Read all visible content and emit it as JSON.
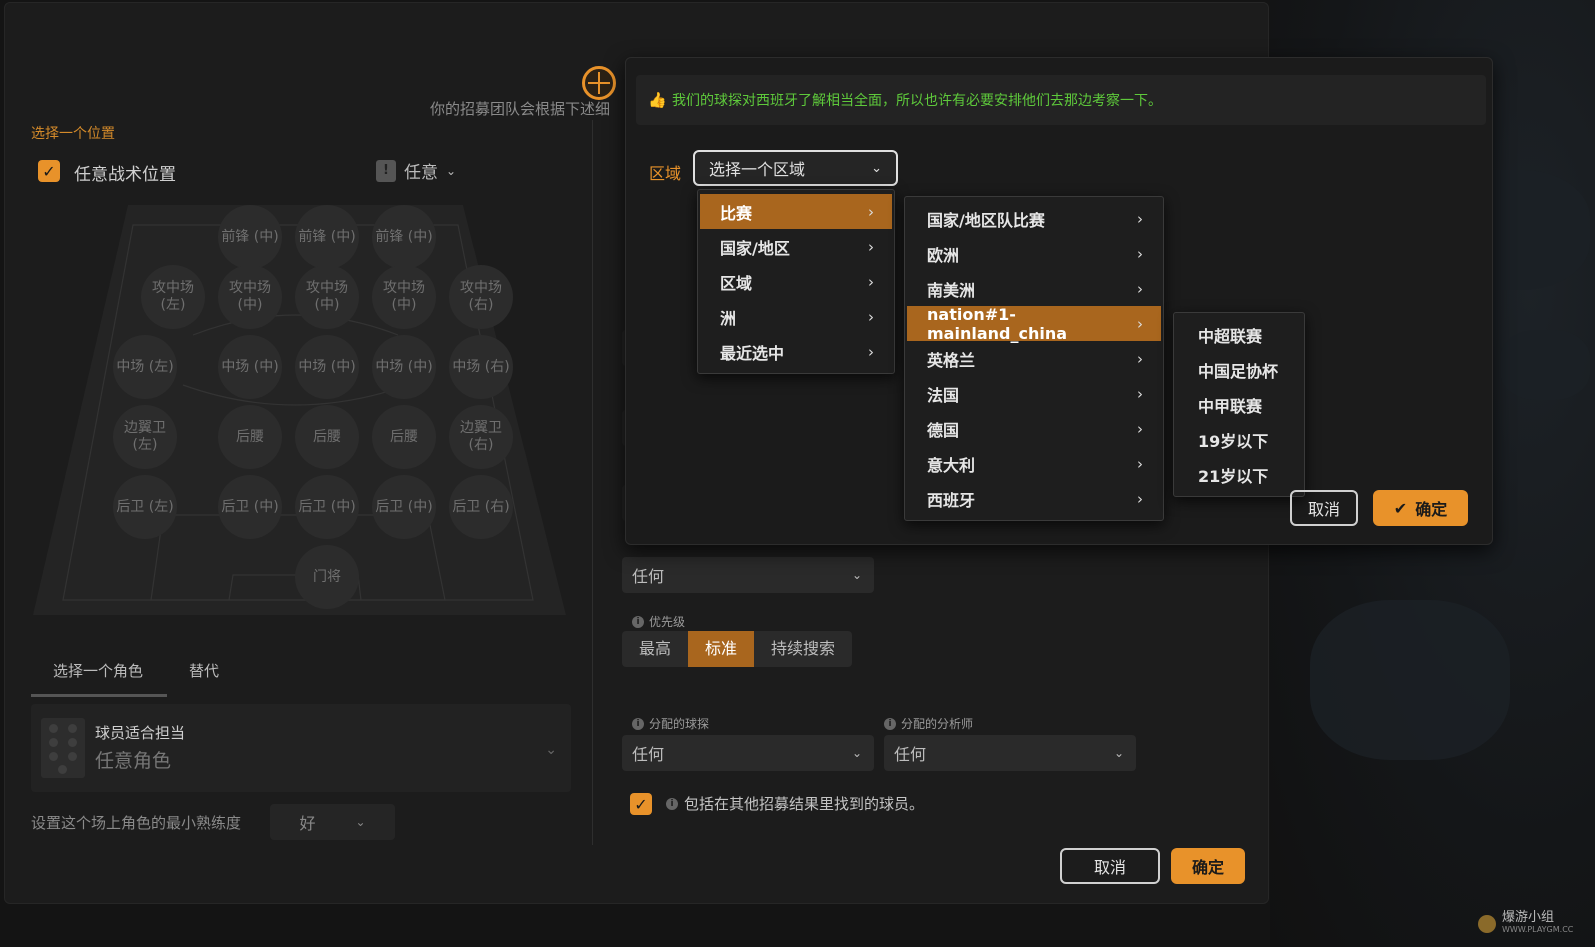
{
  "header": {
    "subtitle": "你的招募团队会根据下述细"
  },
  "left": {
    "position_title": "选择一个位置",
    "any_tactical_position": "任意战术位置",
    "any_selector": "任意",
    "pitch_positions": [
      {
        "label": "前锋 (中)"
      },
      {
        "label": "前锋 (中)"
      },
      {
        "label": "前锋 (中)"
      },
      {
        "label": "攻中场\n(左)"
      },
      {
        "label": "攻中场\n(中)"
      },
      {
        "label": "攻中场\n(中)"
      },
      {
        "label": "攻中场\n(中)"
      },
      {
        "label": "攻中场\n(右)"
      },
      {
        "label": "中场 (左)"
      },
      {
        "label": "中场 (中)"
      },
      {
        "label": "中场 (中)"
      },
      {
        "label": "中场 (中)"
      },
      {
        "label": "中场 (右)"
      },
      {
        "label": "边翼卫\n(左)"
      },
      {
        "label": "后腰"
      },
      {
        "label": "后腰"
      },
      {
        "label": "后腰"
      },
      {
        "label": "边翼卫\n(右)"
      },
      {
        "label": "后卫 (左)"
      },
      {
        "label": "后卫 (中)"
      },
      {
        "label": "后卫 (中)"
      },
      {
        "label": "后卫 (中)"
      },
      {
        "label": "后卫 (右)"
      },
      {
        "label": "门将"
      }
    ],
    "tabs": {
      "role": "选择一个角色",
      "alt": "替代"
    },
    "role_hint": "球员适合担当",
    "role_value": "任意角色",
    "min_skill_label": "设置这个场上角色的最小熟练度",
    "min_skill_value": "好"
  },
  "right": {
    "select_any_1": "任何",
    "priority_label": "优先级",
    "priority_options": [
      "最高",
      "标准",
      "持续搜索"
    ],
    "priority_selected": "标准",
    "scout_label": "分配的球探",
    "scout_value": "任何",
    "analyst_label": "分配的分析师",
    "analyst_value": "任何",
    "include_label": "包括在其他招募结果里找到的球员。",
    "cancel": "取消",
    "confirm": "确定"
  },
  "dialog": {
    "notice": "我们的球探对西班牙了解相当全面，所以也许有必要安排他们去那边考察一下。",
    "region_label": "区域",
    "region_select": "选择一个区域",
    "menu_l1": [
      "比赛",
      "国家/地区",
      "区域",
      "洲",
      "最近选中"
    ],
    "menu_l2": [
      "国家/地区队比赛",
      "欧洲",
      "南美洲",
      "nation#1-mainland_china",
      "英格兰",
      "法国",
      "德国",
      "意大利",
      "西班牙"
    ],
    "menu_l3": [
      "中超联赛",
      "中国足协杯",
      "中甲联赛",
      "19岁以下",
      "21岁以下"
    ],
    "cancel": "取消",
    "confirm": "确定"
  },
  "watermark": {
    "text": "爆游小组",
    "url": "WWW.PLAYGM.CC"
  },
  "colors": {
    "accent": "#e8922a",
    "accent_dark": "#a9661e",
    "notice_green": "#5ec93b",
    "panel_bg": "#1c1c1c"
  }
}
